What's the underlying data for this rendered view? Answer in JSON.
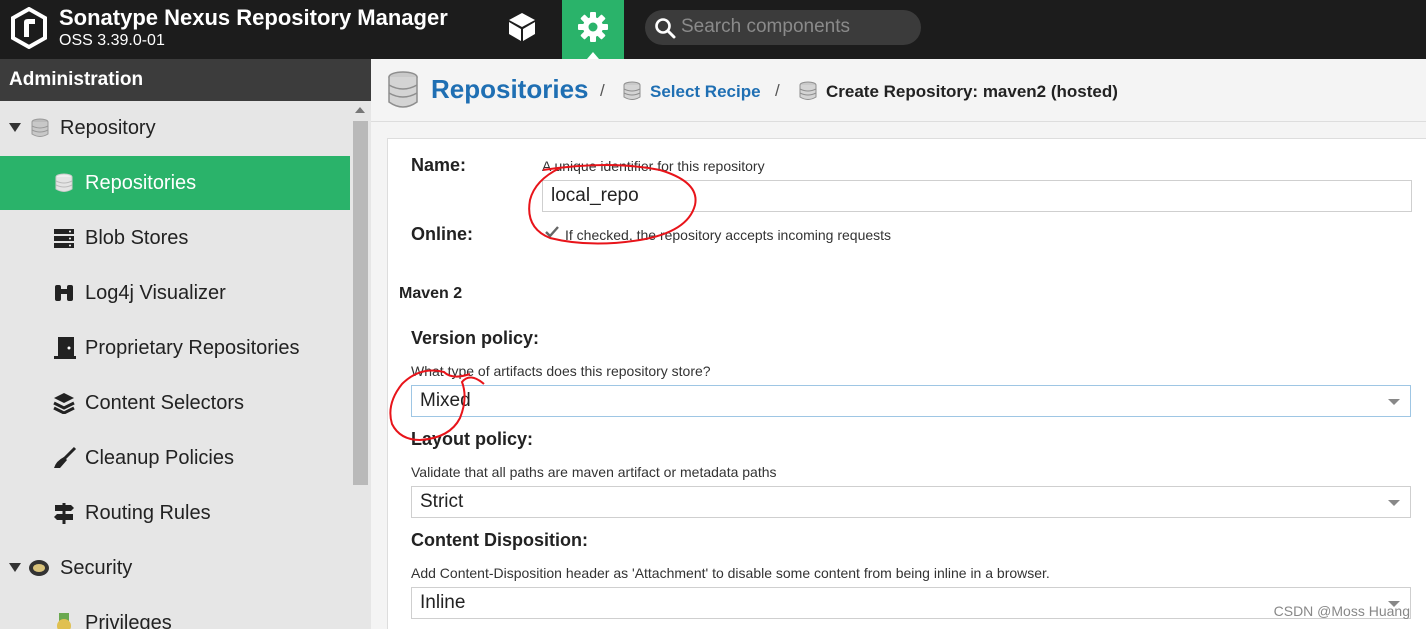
{
  "header": {
    "title": "Sonatype Nexus Repository Manager",
    "version": "OSS 3.39.0-01",
    "search_placeholder": "Search components",
    "browse_icon": "cube-icon",
    "admin_icon": "gear-icon",
    "accent_color": "#2ab36a"
  },
  "sidebar": {
    "heading": "Administration",
    "items": [
      {
        "label": "Repository",
        "icon": "database-icon"
      },
      {
        "label": "Repositories",
        "icon": "database-icon",
        "active": true
      },
      {
        "label": "Blob Stores",
        "icon": "server-icon"
      },
      {
        "label": "Log4j Visualizer",
        "icon": "binoculars-icon"
      },
      {
        "label": "Proprietary Repositories",
        "icon": "door-icon"
      },
      {
        "label": "Content Selectors",
        "icon": "layers-icon"
      },
      {
        "label": "Cleanup Policies",
        "icon": "broom-icon"
      },
      {
        "label": "Routing Rules",
        "icon": "signpost-icon"
      },
      {
        "label": "Security",
        "icon": "badge-icon"
      },
      {
        "label": "Privileges",
        "icon": "medal-icon"
      }
    ]
  },
  "breadcrumb": {
    "root": "Repositories",
    "sep": "/",
    "link": "Select Recipe",
    "current": "Create Repository: maven2 (hosted)"
  },
  "form": {
    "name_label": "Name:",
    "name_help": "A unique identifier for this repository",
    "name_value": "local_repo",
    "online_label": "Online:",
    "online_help": "If checked, the repository accepts incoming requests",
    "online_checked": true,
    "section": "Maven 2",
    "version_label": "Version policy:",
    "version_help": "What type of artifacts does this repository store?",
    "version_value": "Mixed",
    "layout_label": "Layout policy:",
    "layout_help": "Validate that all paths are maven artifact or metadata paths",
    "layout_value": "Strict",
    "disposition_label": "Content Disposition:",
    "disposition_help": "Add Content-Disposition header as 'Attachment' to disable some content from being inline in a browser.",
    "disposition_value": "Inline"
  },
  "watermark": "CSDN @Moss Huang"
}
